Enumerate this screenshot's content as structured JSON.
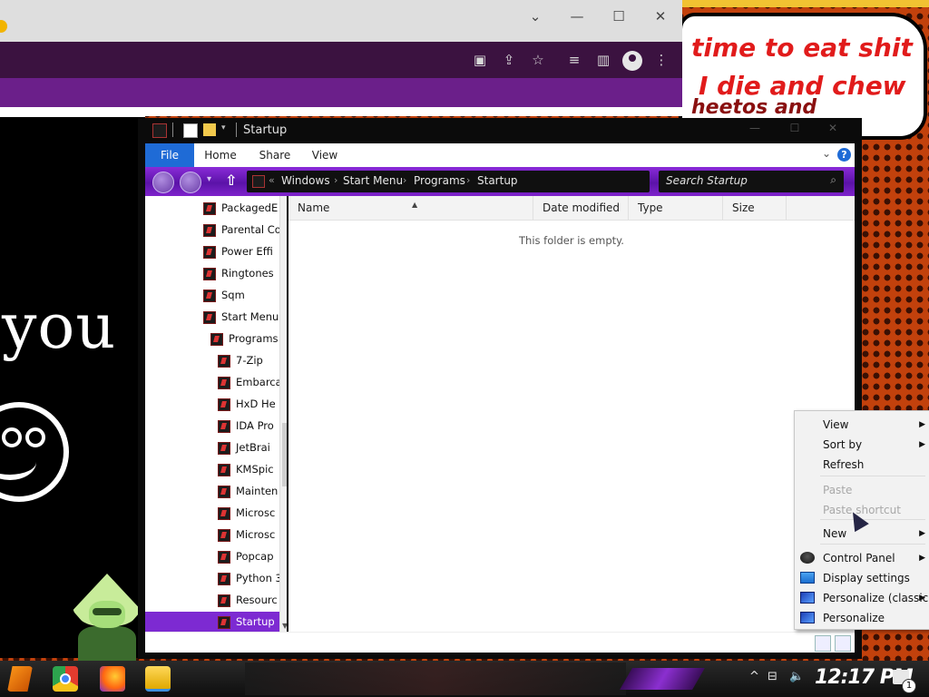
{
  "desktop": {
    "bubble_lines": [
      "time to eat shit",
      "I die and chew",
      "heetos and"
    ],
    "big_text": "you a"
  },
  "browser": {
    "controls": {
      "minimize": "—",
      "maximize": "☐",
      "close": "✕",
      "collapse": "⌄"
    }
  },
  "explorer": {
    "title": "Startup",
    "ribbon_tabs": [
      "File",
      "Home",
      "Share",
      "View"
    ],
    "help_label": "?",
    "breadcrumb": [
      "Windows",
      "Start Menu",
      "Programs",
      "Startup"
    ],
    "breadcrumb_overflow": "«",
    "search_placeholder": "Search Startup",
    "nav_items": [
      {
        "label": "PackagedE",
        "indent": 0
      },
      {
        "label": "Parental Co",
        "indent": 0
      },
      {
        "label": "Power Effi",
        "indent": 0
      },
      {
        "label": "Ringtones",
        "indent": 0
      },
      {
        "label": "Sqm",
        "indent": 0
      },
      {
        "label": "Start Menu",
        "indent": 0
      },
      {
        "label": "Programs",
        "indent": 1
      },
      {
        "label": "7-Zip",
        "indent": 2
      },
      {
        "label": "Embarca",
        "indent": 2
      },
      {
        "label": "HxD He",
        "indent": 2
      },
      {
        "label": "IDA Pro",
        "indent": 2
      },
      {
        "label": "JetBrai",
        "indent": 2
      },
      {
        "label": "KMSpic",
        "indent": 2
      },
      {
        "label": "Mainten",
        "indent": 2
      },
      {
        "label": "Microsc",
        "indent": 2
      },
      {
        "label": "Microsc",
        "indent": 2
      },
      {
        "label": "Popcap",
        "indent": 2
      },
      {
        "label": "Python 3",
        "indent": 2
      },
      {
        "label": "Resourc",
        "indent": 2
      },
      {
        "label": "Startup",
        "indent": 2,
        "selected": true
      }
    ],
    "columns": [
      "Name",
      "Date modified",
      "Type",
      "Size"
    ],
    "empty_message": "This folder is empty."
  },
  "context_menu": {
    "items": [
      {
        "label": "View",
        "submenu": true,
        "disabled": false
      },
      {
        "label": "Sort by",
        "submenu": true,
        "disabled": false
      },
      {
        "label": "Refresh",
        "submenu": false,
        "disabled": false
      },
      {
        "label": "Paste",
        "submenu": false,
        "disabled": true
      },
      {
        "label": "Paste shortcut",
        "submenu": false,
        "disabled": true
      },
      {
        "label": "New",
        "submenu": true,
        "disabled": false
      },
      {
        "label": "Control Panel",
        "submenu": true,
        "disabled": false,
        "icon": "control-panel-icon"
      },
      {
        "label": "Display settings",
        "submenu": false,
        "disabled": false,
        "icon": "display-settings-icon"
      },
      {
        "label": "Personalize (classic)",
        "submenu": true,
        "disabled": false,
        "icon": "personalize-classic-icon"
      },
      {
        "label": "Personalize",
        "submenu": false,
        "disabled": false,
        "icon": "personalize-icon"
      }
    ]
  },
  "taskbar": {
    "clock": "12:17 PM",
    "notification_count": "1",
    "apps": [
      "start-icon",
      "chrome-icon",
      "firefox-icon",
      "file-explorer-icon"
    ]
  },
  "colors": {
    "accent_purple": "#7d2ad2",
    "file_tab_blue": "#1f6bd6",
    "bubble_text_red": "#e11b1b"
  }
}
